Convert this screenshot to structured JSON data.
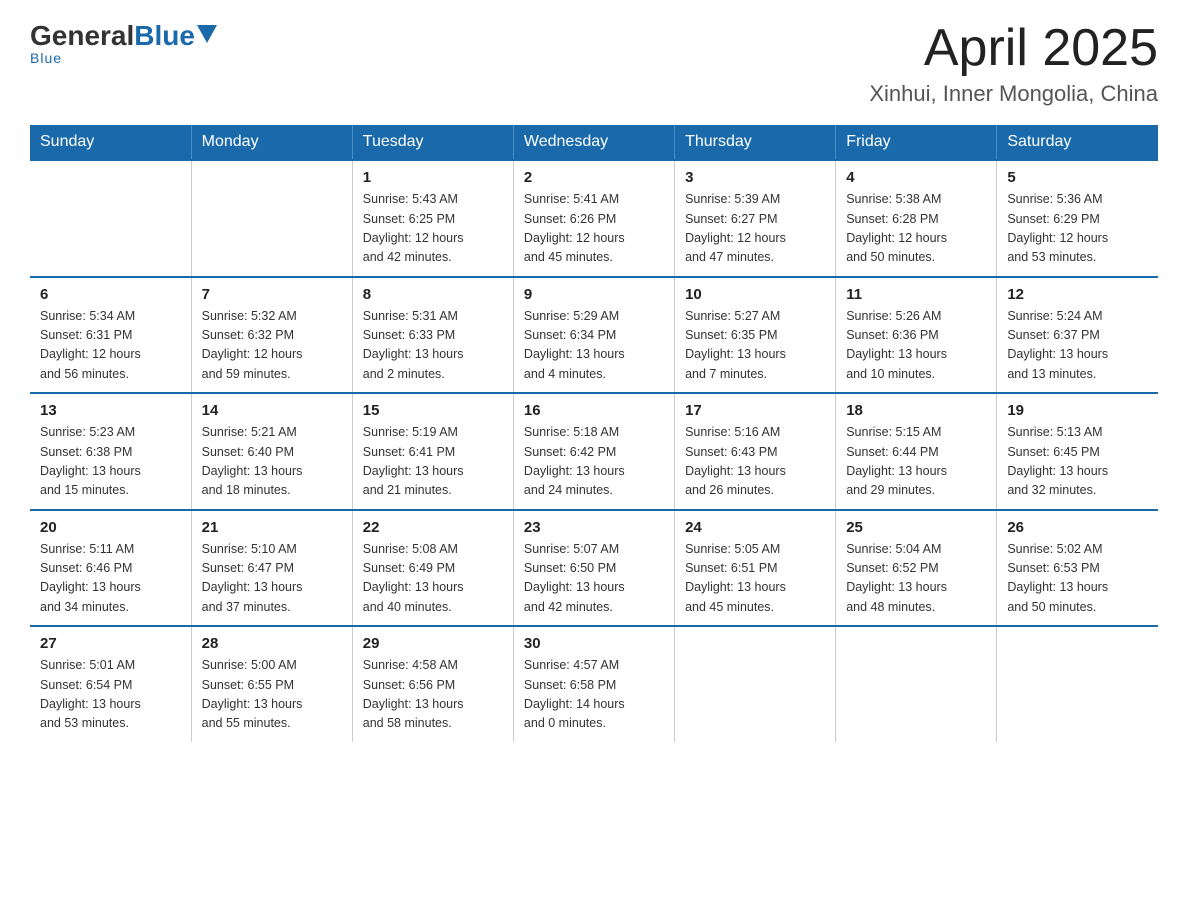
{
  "header": {
    "logo_general": "General",
    "logo_blue": "Blue",
    "month_title": "April 2025",
    "location": "Xinhui, Inner Mongolia, China"
  },
  "weekdays": [
    "Sunday",
    "Monday",
    "Tuesday",
    "Wednesday",
    "Thursday",
    "Friday",
    "Saturday"
  ],
  "weeks": [
    [
      {
        "day": "",
        "info": ""
      },
      {
        "day": "",
        "info": ""
      },
      {
        "day": "1",
        "info": "Sunrise: 5:43 AM\nSunset: 6:25 PM\nDaylight: 12 hours\nand 42 minutes."
      },
      {
        "day": "2",
        "info": "Sunrise: 5:41 AM\nSunset: 6:26 PM\nDaylight: 12 hours\nand 45 minutes."
      },
      {
        "day": "3",
        "info": "Sunrise: 5:39 AM\nSunset: 6:27 PM\nDaylight: 12 hours\nand 47 minutes."
      },
      {
        "day": "4",
        "info": "Sunrise: 5:38 AM\nSunset: 6:28 PM\nDaylight: 12 hours\nand 50 minutes."
      },
      {
        "day": "5",
        "info": "Sunrise: 5:36 AM\nSunset: 6:29 PM\nDaylight: 12 hours\nand 53 minutes."
      }
    ],
    [
      {
        "day": "6",
        "info": "Sunrise: 5:34 AM\nSunset: 6:31 PM\nDaylight: 12 hours\nand 56 minutes."
      },
      {
        "day": "7",
        "info": "Sunrise: 5:32 AM\nSunset: 6:32 PM\nDaylight: 12 hours\nand 59 minutes."
      },
      {
        "day": "8",
        "info": "Sunrise: 5:31 AM\nSunset: 6:33 PM\nDaylight: 13 hours\nand 2 minutes."
      },
      {
        "day": "9",
        "info": "Sunrise: 5:29 AM\nSunset: 6:34 PM\nDaylight: 13 hours\nand 4 minutes."
      },
      {
        "day": "10",
        "info": "Sunrise: 5:27 AM\nSunset: 6:35 PM\nDaylight: 13 hours\nand 7 minutes."
      },
      {
        "day": "11",
        "info": "Sunrise: 5:26 AM\nSunset: 6:36 PM\nDaylight: 13 hours\nand 10 minutes."
      },
      {
        "day": "12",
        "info": "Sunrise: 5:24 AM\nSunset: 6:37 PM\nDaylight: 13 hours\nand 13 minutes."
      }
    ],
    [
      {
        "day": "13",
        "info": "Sunrise: 5:23 AM\nSunset: 6:38 PM\nDaylight: 13 hours\nand 15 minutes."
      },
      {
        "day": "14",
        "info": "Sunrise: 5:21 AM\nSunset: 6:40 PM\nDaylight: 13 hours\nand 18 minutes."
      },
      {
        "day": "15",
        "info": "Sunrise: 5:19 AM\nSunset: 6:41 PM\nDaylight: 13 hours\nand 21 minutes."
      },
      {
        "day": "16",
        "info": "Sunrise: 5:18 AM\nSunset: 6:42 PM\nDaylight: 13 hours\nand 24 minutes."
      },
      {
        "day": "17",
        "info": "Sunrise: 5:16 AM\nSunset: 6:43 PM\nDaylight: 13 hours\nand 26 minutes."
      },
      {
        "day": "18",
        "info": "Sunrise: 5:15 AM\nSunset: 6:44 PM\nDaylight: 13 hours\nand 29 minutes."
      },
      {
        "day": "19",
        "info": "Sunrise: 5:13 AM\nSunset: 6:45 PM\nDaylight: 13 hours\nand 32 minutes."
      }
    ],
    [
      {
        "day": "20",
        "info": "Sunrise: 5:11 AM\nSunset: 6:46 PM\nDaylight: 13 hours\nand 34 minutes."
      },
      {
        "day": "21",
        "info": "Sunrise: 5:10 AM\nSunset: 6:47 PM\nDaylight: 13 hours\nand 37 minutes."
      },
      {
        "day": "22",
        "info": "Sunrise: 5:08 AM\nSunset: 6:49 PM\nDaylight: 13 hours\nand 40 minutes."
      },
      {
        "day": "23",
        "info": "Sunrise: 5:07 AM\nSunset: 6:50 PM\nDaylight: 13 hours\nand 42 minutes."
      },
      {
        "day": "24",
        "info": "Sunrise: 5:05 AM\nSunset: 6:51 PM\nDaylight: 13 hours\nand 45 minutes."
      },
      {
        "day": "25",
        "info": "Sunrise: 5:04 AM\nSunset: 6:52 PM\nDaylight: 13 hours\nand 48 minutes."
      },
      {
        "day": "26",
        "info": "Sunrise: 5:02 AM\nSunset: 6:53 PM\nDaylight: 13 hours\nand 50 minutes."
      }
    ],
    [
      {
        "day": "27",
        "info": "Sunrise: 5:01 AM\nSunset: 6:54 PM\nDaylight: 13 hours\nand 53 minutes."
      },
      {
        "day": "28",
        "info": "Sunrise: 5:00 AM\nSunset: 6:55 PM\nDaylight: 13 hours\nand 55 minutes."
      },
      {
        "day": "29",
        "info": "Sunrise: 4:58 AM\nSunset: 6:56 PM\nDaylight: 13 hours\nand 58 minutes."
      },
      {
        "day": "30",
        "info": "Sunrise: 4:57 AM\nSunset: 6:58 PM\nDaylight: 14 hours\nand 0 minutes."
      },
      {
        "day": "",
        "info": ""
      },
      {
        "day": "",
        "info": ""
      },
      {
        "day": "",
        "info": ""
      }
    ]
  ]
}
